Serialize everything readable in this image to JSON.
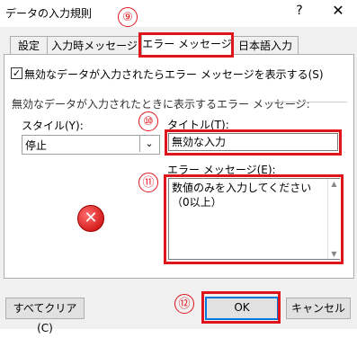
{
  "window": {
    "title": "データの入力規則",
    "help_glyph": "?",
    "close_glyph": "✕"
  },
  "tabs": [
    {
      "label": "設定"
    },
    {
      "label": "入力時メッセージ"
    },
    {
      "label": "エラー メッセージ"
    },
    {
      "label": "日本語入力"
    }
  ],
  "show_error": {
    "checked": true,
    "label": "無効なデータが入力されたらエラー メッセージを表示する(S)"
  },
  "group_label": "無効なデータが入力されたときに表示するエラー メッセージ:",
  "style": {
    "label": "スタイル(Y):",
    "value": "停止"
  },
  "title_field": {
    "label": "タイトル(T):",
    "value": "無効な入力"
  },
  "message_field": {
    "label": "エラー メッセージ(E):",
    "value": "数値のみを入力してください（0以上）"
  },
  "buttons": {
    "clear_all": "すべてクリア(C)",
    "ok": "OK",
    "cancel": "キャンセル"
  },
  "annotations": [
    "⑨",
    "⑩",
    "⑪",
    "⑫"
  ],
  "colors": {
    "highlight": "#e0151c",
    "focus": "#0078d7"
  }
}
